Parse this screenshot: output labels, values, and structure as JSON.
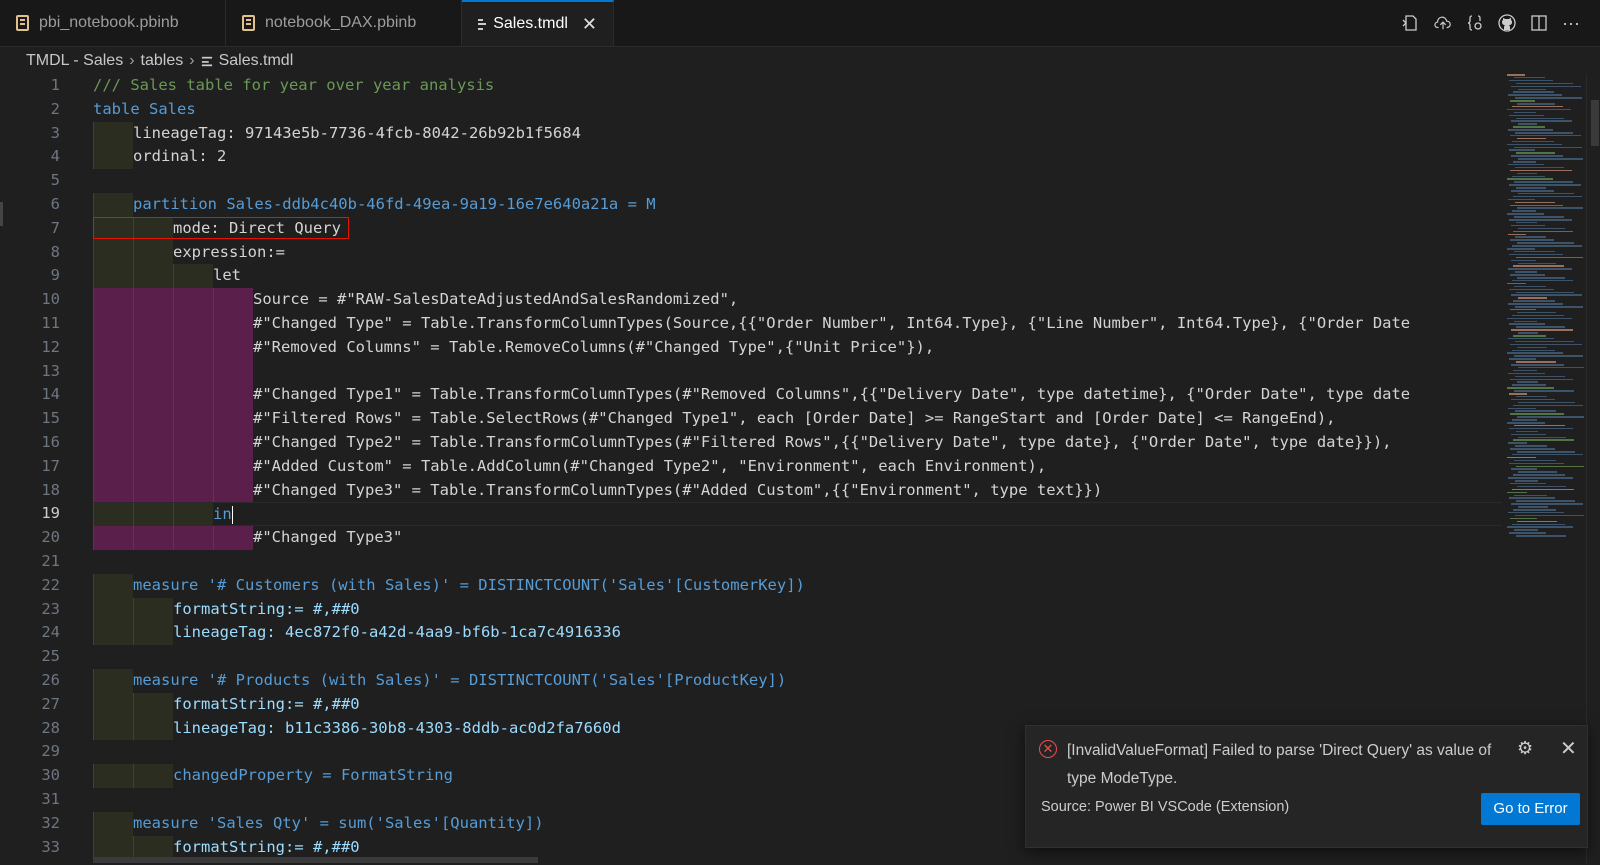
{
  "tabs": [
    {
      "label": "pbi_notebook.pbinb",
      "icon": "notebook-icon"
    },
    {
      "label": "notebook_DAX.pbinb",
      "icon": "notebook-icon"
    },
    {
      "label": "Sales.tmdl",
      "icon": "lines-icon",
      "active": true
    }
  ],
  "toolbar_icons": [
    "open-changes-icon",
    "cloud-upload-icon",
    "braces-icon",
    "github-icon",
    "split-editor-icon",
    "more-icon"
  ],
  "breadcrumb": [
    "TMDL - Sales",
    "tables",
    "Sales.tmdl"
  ],
  "current_line": 19,
  "error_highlight_line": 7,
  "line_numbers": [
    "1",
    "2",
    "3",
    "4",
    "5",
    "6",
    "7",
    "8",
    "9",
    "10",
    "11",
    "12",
    "13",
    "14",
    "15",
    "16",
    "17",
    "18",
    "19",
    "20",
    "21",
    "22",
    "23",
    "24",
    "25",
    "26",
    "27",
    "28",
    "29",
    "30",
    "31",
    "32",
    "33"
  ],
  "code_lines": [
    "/// Sales table for year over year analysis",
    "table Sales",
    "lineageTag: 97143e5b-7736-4fcb-8042-26b92b1f5684",
    "ordinal: 2",
    "",
    "partition Sales-ddb4c40b-46fd-49ea-9a19-16e7e640a21a = M",
    "mode: Direct Query",
    "expression:=",
    "let",
    "Source = #\"RAW-SalesDateAdjustedAndSalesRandomized\",",
    "#\"Changed Type\" = Table.TransformColumnTypes(Source,{{\"Order Number\", Int64.Type}, {\"Line Number\", Int64.Type}, {\"Order Date",
    "#\"Removed Columns\" = Table.RemoveColumns(#\"Changed Type\",{\"Unit Price\"}),",
    "",
    "#\"Changed Type1\" = Table.TransformColumnTypes(#\"Removed Columns\",{{\"Delivery Date\", type datetime}, {\"Order Date\", type date",
    "#\"Filtered Rows\" = Table.SelectRows(#\"Changed Type1\", each [Order Date] >= RangeStart and [Order Date] <= RangeEnd),",
    "#\"Changed Type2\" = Table.TransformColumnTypes(#\"Filtered Rows\",{{\"Delivery Date\", type date}, {\"Order Date\", type date}}),",
    "#\"Added Custom\" = Table.AddColumn(#\"Changed Type2\", \"Environment\", each Environment),",
    "#\"Changed Type3\" = Table.TransformColumnTypes(#\"Added Custom\",{{\"Environment\", type text}})",
    "in",
    "#\"Changed Type3\"",
    "",
    "measure '# Customers (with Sales)' = DISTINCTCOUNT('Sales'[CustomerKey])",
    "formatString:= #,##0",
    "lineageTag: 4ec872f0-a42d-4aa9-bf6b-1ca7c4916336",
    "",
    "measure '# Products (with Sales)' = DISTINCTCOUNT('Sales'[ProductKey])",
    "formatString:= #,##0",
    "lineageTag: b11c3386-30b8-4303-8ddb-ac0d2fa7660d",
    "",
    "changedProperty = FormatString",
    "",
    "measure 'Sales Qty' = sum('Sales'[Quantity])",
    "formatString:= #,##0"
  ],
  "notification": {
    "message": "[InvalidValueFormat] Failed to parse 'Direct Query' as value of type ModeType.",
    "source": "Source: Power BI VSCode (Extension)",
    "action": "Go to Error",
    "icons": [
      "error-icon",
      "gear-icon",
      "close-icon"
    ]
  },
  "colors": {
    "accent": "#0078d4",
    "error": "#f14c4c",
    "keyword": "#569cd6",
    "comment": "#6a9955",
    "string": "#ce9178",
    "guid": "#4ec9b0",
    "expression_bg": "#5a1f4a"
  }
}
